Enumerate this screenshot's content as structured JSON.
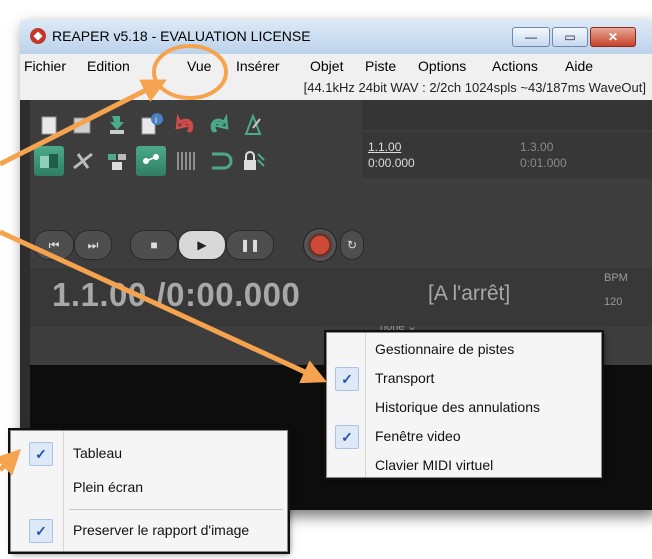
{
  "window": {
    "title": "REAPER v5.18 - EVALUATION LICENSE",
    "controls": {
      "minimize": "—",
      "maximize": "▭",
      "close": "✕"
    }
  },
  "menubar": {
    "items": [
      "Fichier",
      "Edition",
      "Vue",
      "Insérer",
      "Objet",
      "Piste",
      "Options",
      "Actions",
      "Aide"
    ]
  },
  "status": "[44.1kHz 24bit WAV : 2/2ch 1024spls ~43/187ms WaveOut]",
  "timeline": {
    "marker1_bar": "1.1.00",
    "marker1_time": "0:00.000",
    "marker2_bar": "1.3.00",
    "marker2_time": "0:01.000"
  },
  "transport": {
    "timecode": "1.1.00 /0:00.000",
    "state": "[A l'arrêt]",
    "bpm_label": "BPM",
    "bpm_value": "120",
    "grid_select": "none"
  },
  "menu_vue_windows": {
    "items": [
      {
        "label": "Gestionnaire de pistes",
        "checked": false
      },
      {
        "label": "Transport",
        "checked": true
      },
      {
        "label": "Historique des annulations",
        "checked": false
      },
      {
        "label": "Fenêtre video",
        "checked": true
      },
      {
        "label": "Clavier MIDI virtuel",
        "checked": false
      }
    ]
  },
  "menu_video": {
    "items": [
      {
        "label": "Tableau",
        "checked": true
      },
      {
        "label": "Plein écran",
        "checked": false
      },
      {
        "label": "Preserver le rapport d'image",
        "checked": true
      }
    ]
  },
  "colors": {
    "annotation": "#f5a34e",
    "daw_bg": "#3d3d3d",
    "check_blue": "#2156a8"
  },
  "icons": {
    "check": "✓"
  }
}
